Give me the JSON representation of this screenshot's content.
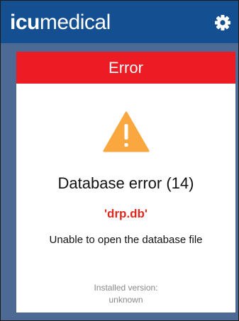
{
  "header": {
    "logo_bold": "icu",
    "logo_light": "medical",
    "settings_icon": "gear-icon",
    "background_color": "#144f92"
  },
  "dialog": {
    "header_title": "Error",
    "header_color": "#ed1c24",
    "warning_icon": "warning-triangle-icon",
    "warning_color": "#f9a73e",
    "error_title": "Database error (14)",
    "error_file": "'drp.db'",
    "error_message": "Unable to open the database file",
    "version_label": "Installed version:",
    "version_value": "unknown"
  }
}
